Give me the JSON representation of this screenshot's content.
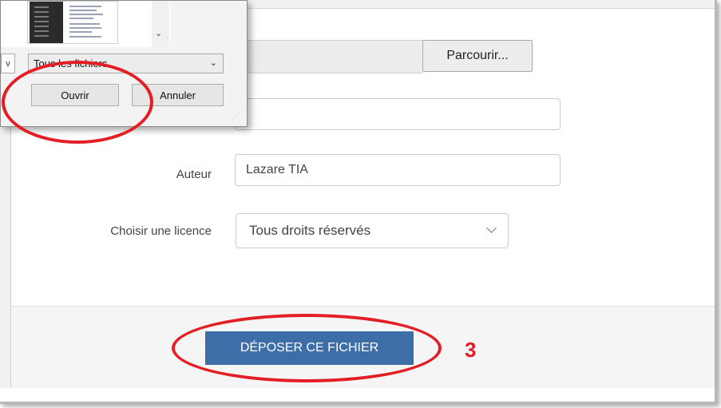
{
  "form": {
    "browse_label": "Parcourir...",
    "title_value": "",
    "author_label": "Auteur",
    "author_value": "Lazare TIA",
    "license_label": "Choisir une licence",
    "license_value": "Tous droits réservés",
    "submit_label": "DÉPOSER CE FICHIER",
    "step_number": "3"
  },
  "dialog": {
    "left_dropdown_value": "v",
    "filter_value": "Tous les fichiers",
    "open_label": "Ouvrir",
    "cancel_label": "Annuler"
  },
  "colors": {
    "submit_bg": "#3e6ea8",
    "annotation_red": "#e31e24"
  },
  "icons": {
    "select_chevron": "chevron-down-icon",
    "dialog_grip": "resize-grip-icon"
  }
}
